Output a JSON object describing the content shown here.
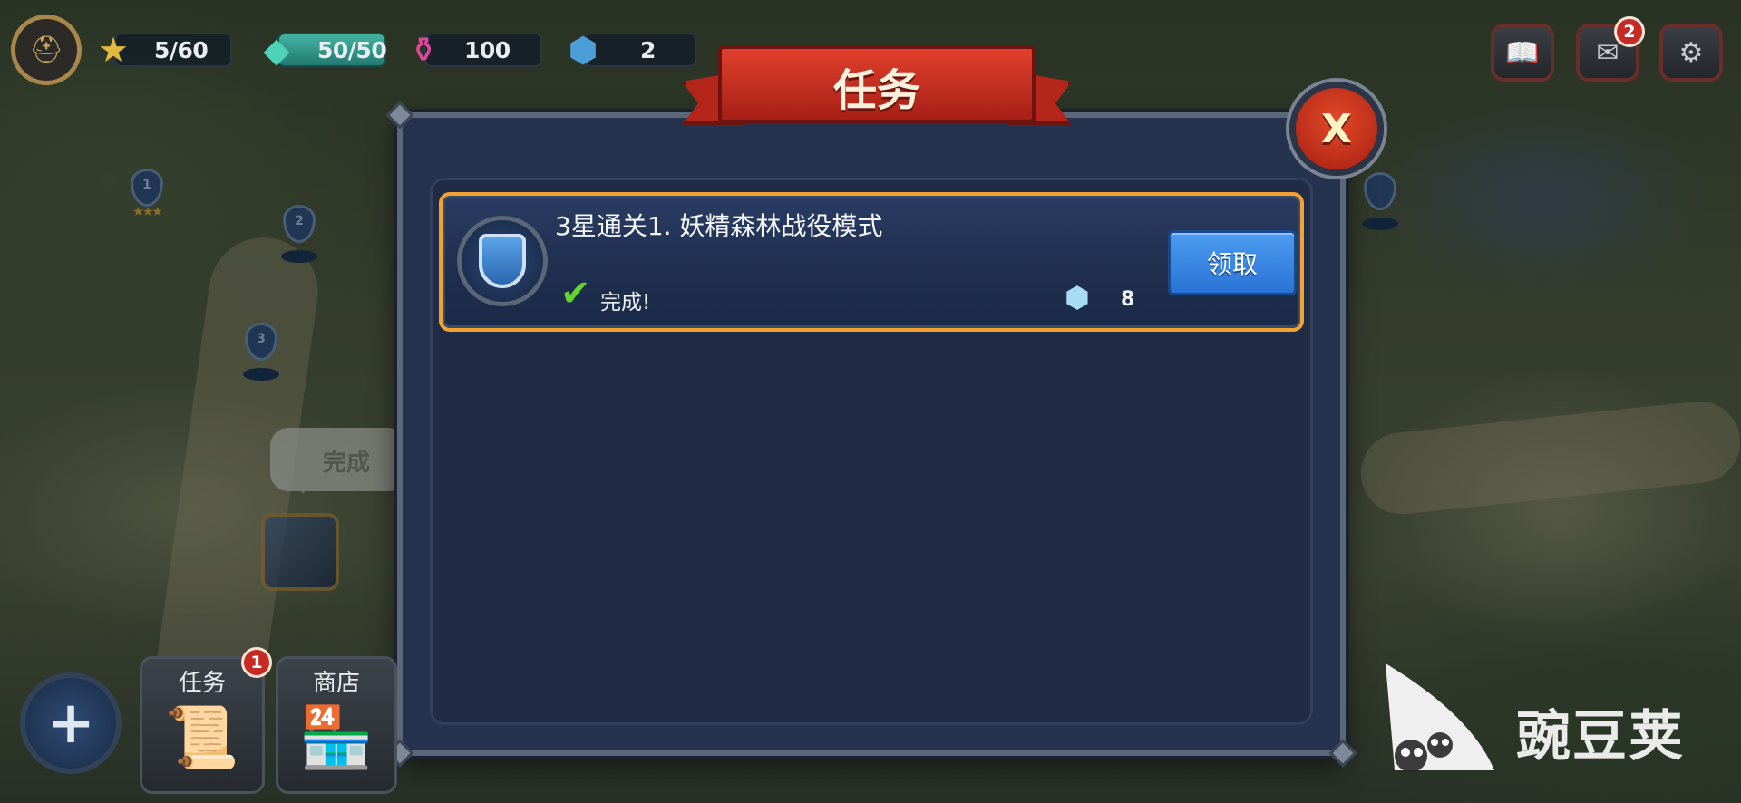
{
  "resources": {
    "stars": "5/60",
    "energy": "50/50",
    "potions": "100",
    "gems": "2"
  },
  "top_icons": {
    "profile": "helmet-icon",
    "star": "star-icon",
    "energy": "crystal-icon",
    "potion": "potion-icon",
    "gem": "gem-icon",
    "encyclopedia": "book-icon",
    "mail": "mail-icon",
    "settings": "gear-icon"
  },
  "mail_badge": "2",
  "dialog": {
    "title": "任务",
    "close_label": "X",
    "quest": {
      "title": "3星通关1. 妖精森林战役模式",
      "status": "完成!",
      "reward_amount": "8",
      "claim_label": "领取"
    }
  },
  "map": {
    "pins": [
      "1",
      "2",
      "3"
    ],
    "speech_text": "完成"
  },
  "bottom_menu": {
    "quests_label": "任务",
    "quests_badge": "1",
    "shop_label": "商店"
  },
  "watermark": {
    "text": "豌豆荚"
  },
  "colors": {
    "quest_border": "#f4a133",
    "claim_button": "#2a73d6",
    "banner_red": "#c62d1e",
    "check_green": "#63d62d"
  }
}
